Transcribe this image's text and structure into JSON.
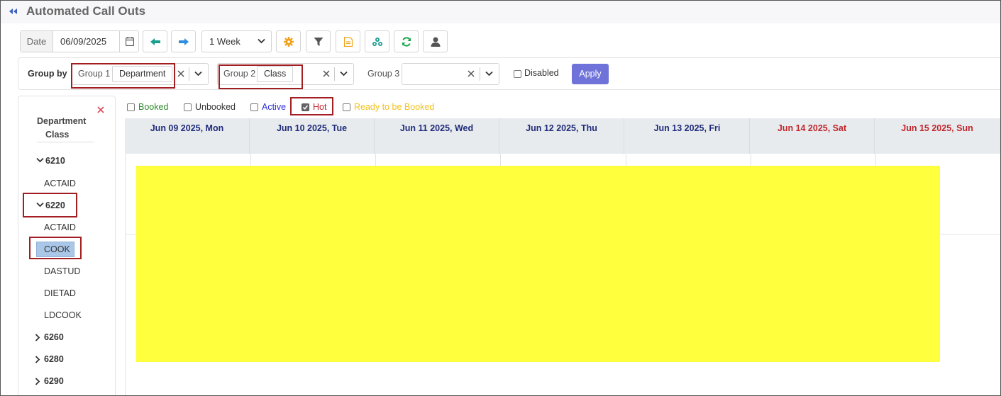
{
  "app": {
    "title": "Automated Call Outs"
  },
  "toolbar": {
    "date_label": "Date",
    "date_value": "06/09/2025",
    "period": "1 Week",
    "buttons": [
      "calendar-icon",
      "prev-arrow-icon",
      "next-arrow-icon",
      "settings-gear-icon",
      "filter-icon",
      "document-icon",
      "share-icon",
      "refresh-icon",
      "user-icon"
    ]
  },
  "groupby": {
    "label": "Group by",
    "group1": {
      "label": "Group 1",
      "value": "Department"
    },
    "group2": {
      "label": "Group 2",
      "value": "Class"
    },
    "group3": {
      "label": "Group 3",
      "value": ""
    },
    "disabled_label": "Disabled",
    "disabled_checked": false,
    "apply_label": "Apply"
  },
  "left_panel": {
    "header_line1": "Department",
    "header_line2": "Class",
    "tree": [
      {
        "label": "6210",
        "expanded": true
      },
      {
        "label": "ACTAID"
      },
      {
        "label": "6220",
        "expanded": true
      },
      {
        "label": "ACTAID"
      },
      {
        "label": "COOK",
        "selected": true
      },
      {
        "label": "DASTUD"
      },
      {
        "label": "DIETAD"
      },
      {
        "label": "LDCOOK"
      },
      {
        "label": "6260",
        "expanded": false
      },
      {
        "label": "6280",
        "expanded": false
      },
      {
        "label": "6290",
        "expanded": false
      }
    ]
  },
  "filters": [
    {
      "label": "Booked",
      "checked": false,
      "color": "#2e8b2e"
    },
    {
      "label": "Unbooked",
      "checked": false,
      "color": "#333333"
    },
    {
      "label": "Active",
      "checked": false,
      "color": "#2f2fd6"
    },
    {
      "label": "Hot",
      "checked": true,
      "color": "#c0272d"
    },
    {
      "label": "Ready to be Booked",
      "checked": false,
      "color": "#f2c21b"
    }
  ],
  "days": [
    {
      "label": "Jun 09 2025, Mon",
      "weekend": false
    },
    {
      "label": "Jun 10 2025, Tue",
      "weekend": false
    },
    {
      "label": "Jun 11 2025, Wed",
      "weekend": false
    },
    {
      "label": "Jun 12 2025, Thu",
      "weekend": false
    },
    {
      "label": "Jun 13 2025, Fri",
      "weekend": false
    },
    {
      "label": "Jun 14 2025, Sat",
      "weekend": true
    },
    {
      "label": "Jun 15 2025, Sun",
      "weekend": true
    }
  ],
  "colors": {
    "accent": "#6f72d9",
    "highlight_box": "#a31e22",
    "yellow_block": "#ffff3d",
    "weekday": "#1f2c7a",
    "weekend": "#c0272d"
  }
}
